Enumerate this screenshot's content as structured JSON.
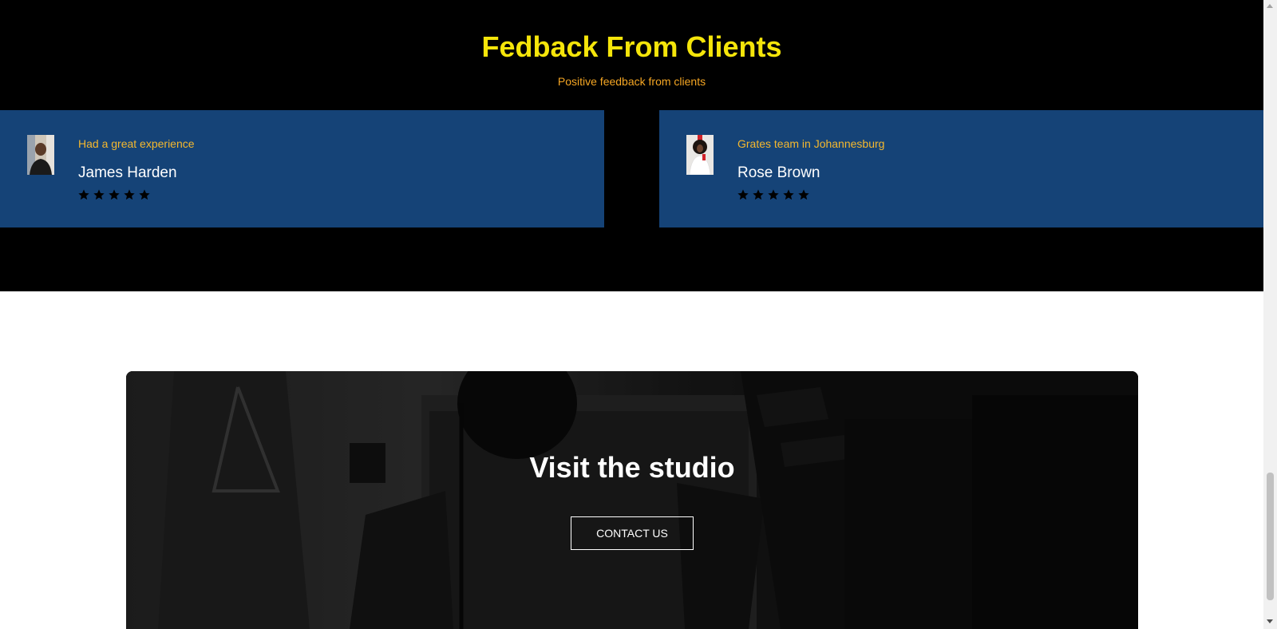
{
  "feedback": {
    "title": "Fedback From Clients",
    "subtitle": "Positive feedback from clients",
    "colors": {
      "background": "#000000",
      "title": "#f5e50a",
      "subtitle": "#f5a623",
      "card": "#154377",
      "quote": "#f5b82e"
    },
    "cards": [
      {
        "quote": "Had a great experience",
        "name": "James Harden",
        "rating": 5,
        "avatar_icon": "client-photo-icon"
      },
      {
        "quote": "Grates team in Johannesburg",
        "name": "Rose Brown",
        "rating": 5,
        "avatar_icon": "client-photo-icon"
      }
    ]
  },
  "studio": {
    "title": "Visit the studio",
    "button_label": "CONTACT US"
  }
}
